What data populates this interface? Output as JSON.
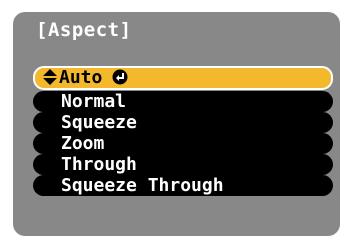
{
  "menu": {
    "title": "[Aspect]",
    "options": [
      {
        "label": "Auto",
        "selected": true
      },
      {
        "label": "Normal",
        "selected": false
      },
      {
        "label": "Squeeze",
        "selected": false
      },
      {
        "label": "Zoom",
        "selected": false
      },
      {
        "label": "Through",
        "selected": false
      },
      {
        "label": "Squeeze Through",
        "selected": false
      }
    ],
    "icons": {
      "selector": "up-down-arrow-icon",
      "confirm": "enter-icon"
    }
  },
  "colors": {
    "panel": "#888888",
    "option_bg": "#000000",
    "selected_bg": "#f3b82c",
    "text": "#ffffff"
  }
}
